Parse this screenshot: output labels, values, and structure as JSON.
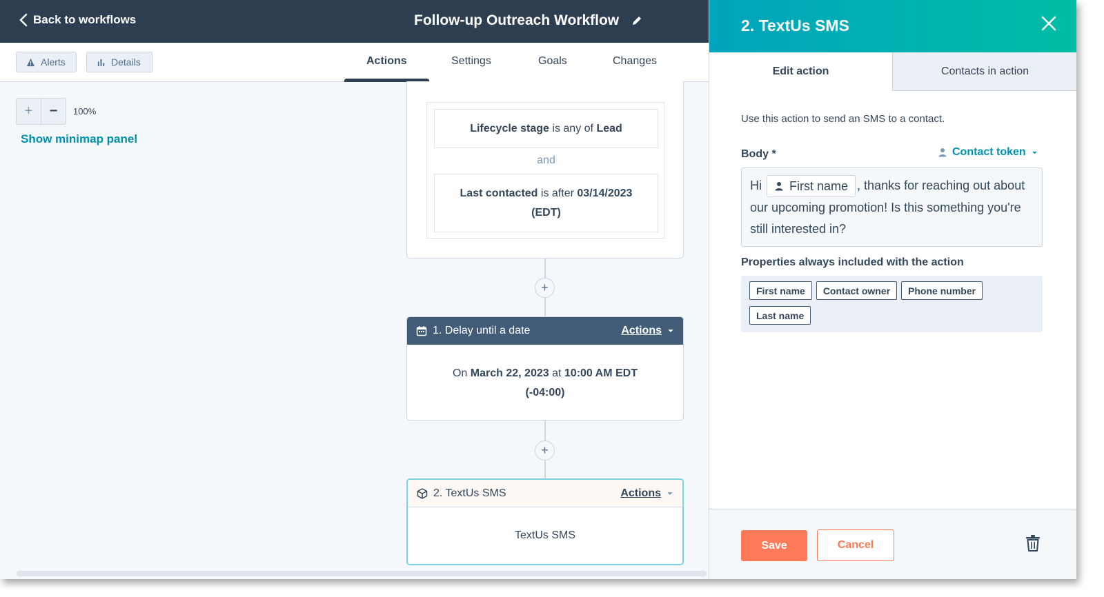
{
  "header": {
    "back_label": "Back to workflows",
    "workflow_title": "Follow-up Outreach Workflow"
  },
  "toolbar": {
    "alerts_label": "Alerts",
    "details_label": "Details"
  },
  "tabs": [
    {
      "label": "Actions",
      "active": true
    },
    {
      "label": "Settings",
      "active": false
    },
    {
      "label": "Goals",
      "active": false
    },
    {
      "label": "Changes",
      "active": false
    }
  ],
  "zoom": {
    "plus": "+",
    "minus": "−",
    "level": "100%",
    "minimap_label": "Show minimap panel"
  },
  "trigger": {
    "filter1": {
      "prop": "Lifecycle stage",
      "op": "is any of",
      "value": "Lead"
    },
    "connector": "and",
    "filter2": {
      "prop": "Last contacted",
      "op": "is after",
      "value": "03/14/2023",
      "suffix": "(EDT)"
    }
  },
  "add_button": "+",
  "delay_action": {
    "title": "1. Delay until a date",
    "actions_label": "Actions",
    "body_prefix": "On",
    "date": "March 22, 2023",
    "at": "at",
    "time": "10:00 AM EDT",
    "offset": "(-04:00)"
  },
  "sms_action": {
    "title": "2. TextUs SMS",
    "actions_label": "Actions",
    "body": "TextUs SMS"
  },
  "panel": {
    "title": "2. TextUs SMS",
    "tab_edit": "Edit action",
    "tab_contacts": "Contacts in action",
    "intro": "Use this action to send an SMS to a contact.",
    "body_label": "Body *",
    "contact_token_label": "Contact token",
    "body_before": "Hi",
    "body_token": "First name",
    "body_after": ", thanks for reaching out about our upcoming promotion! Is this something you're still interested in?",
    "properties_label": "Properties always included with the action",
    "properties": [
      "First name",
      "Contact owner",
      "Phone number",
      "Last name"
    ],
    "save_label": "Save",
    "cancel_label": "Cancel"
  },
  "colors": {
    "header_bg": "#2d3e50",
    "panel_gradient_start": "#00a4bd",
    "panel_gradient_end": "#00bda5",
    "link": "#0091ae",
    "primary": "#ff7a59"
  },
  "icons": [
    "chevron-left-icon",
    "pencil-icon",
    "warning-icon",
    "bar-chart-icon",
    "calendar-icon",
    "cube-icon",
    "caret-down-icon",
    "close-icon",
    "person-icon",
    "trash-icon"
  ]
}
